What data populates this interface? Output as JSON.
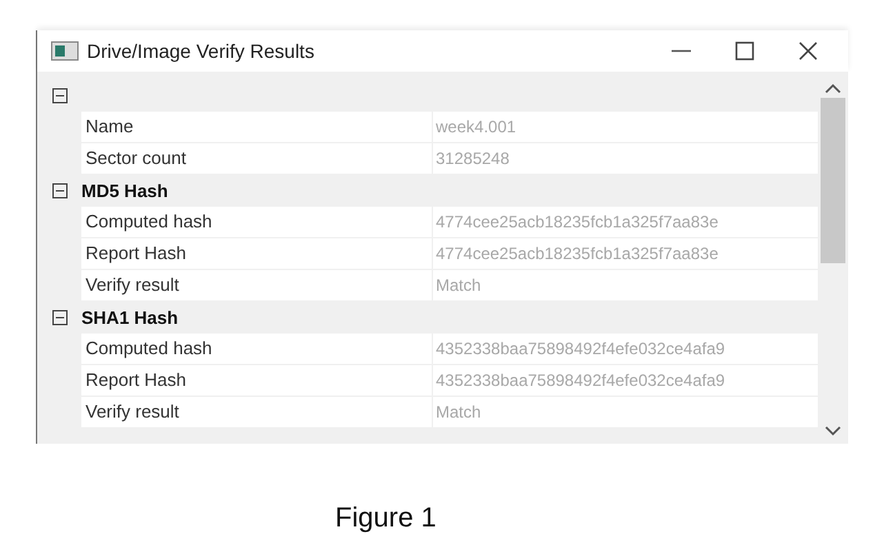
{
  "window": {
    "title": "Drive/Image Verify Results"
  },
  "groups": [
    {
      "expanded": true,
      "rows": [
        {
          "label": "Name",
          "value": "week4.001"
        },
        {
          "label": "Sector count",
          "value": "31285248"
        }
      ]
    },
    {
      "title": "MD5 Hash",
      "expanded": true,
      "rows": [
        {
          "label": "Computed hash",
          "value": "4774cee25acb18235fcb1a325f7aa83e"
        },
        {
          "label": "Report Hash",
          "value": "4774cee25acb18235fcb1a325f7aa83e"
        },
        {
          "label": "Verify result",
          "value": "Match"
        }
      ]
    },
    {
      "title": "SHA1 Hash",
      "expanded": true,
      "rows": [
        {
          "label": "Computed hash",
          "value": "4352338baa75898492f4efe032ce4afa9"
        },
        {
          "label": "Report Hash",
          "value": "4352338baa75898492f4efe032ce4afa9"
        },
        {
          "label": "Verify result",
          "value": "Match"
        }
      ]
    }
  ],
  "caption": "Figure 1"
}
